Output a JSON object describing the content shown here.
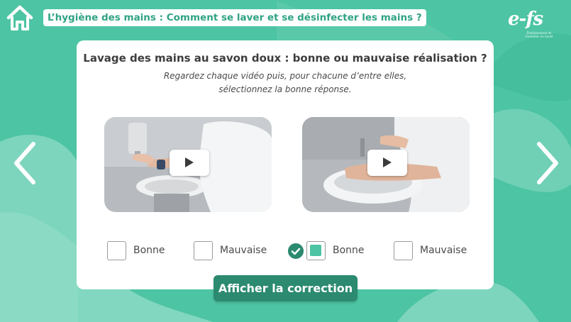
{
  "header": {
    "title": "L’hygiène des mains : Comment se laver et se désinfecter les mains ?",
    "home_icon": "home-icon",
    "logo_text": "e-fs",
    "logo_subtitle": "Établissement de Formation de Santé"
  },
  "navigation": {
    "prev_icon": "chevron-left-icon",
    "next_icon": "chevron-right-icon"
  },
  "exercise": {
    "question": "Lavage des mains au savon doux : bonne ou mauvaise réalisation ?",
    "instruction_line1": "Regardez chaque vidéo puis, pour chacune d’entre elles,",
    "instruction_line2": "sélectionnez la bonne réponse.",
    "videos": [
      {
        "play_icon": "play-icon"
      },
      {
        "play_icon": "play-icon"
      }
    ],
    "choices": [
      {
        "label": "Bonne",
        "checked": false
      },
      {
        "label": "Mauvaise",
        "checked": false
      },
      {
        "label": "Bonne",
        "checked": true
      },
      {
        "label": "Mauvaise",
        "checked": false
      }
    ],
    "correction_button": "Afficher la correction"
  },
  "colors": {
    "background": "#4dc4a3",
    "accent_dark": "#2b8a70",
    "accent": "#4dc4a3",
    "title_text": "#2fa384"
  }
}
